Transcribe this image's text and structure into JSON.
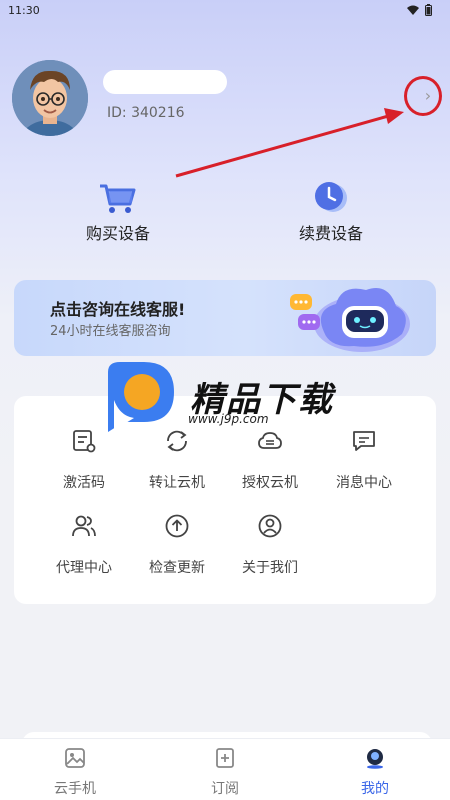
{
  "status_bar": {
    "time": "11:30"
  },
  "profile": {
    "id_text": "ID: 340216",
    "chevron": "›"
  },
  "quick_actions": [
    {
      "label": "购买设备",
      "icon": "cart-icon"
    },
    {
      "label": "续费设备",
      "icon": "clock-icon"
    }
  ],
  "banner": {
    "title": "点击咨询在线客服!",
    "subtitle": "24小时在线客服咨询"
  },
  "watermark": {
    "title": "精品下载",
    "url": "www.j9p.com"
  },
  "menu": [
    {
      "label": "激活码",
      "icon": "activation-code-icon"
    },
    {
      "label": "转让云机",
      "icon": "transfer-icon"
    },
    {
      "label": "授权云机",
      "icon": "cloud-authorize-icon"
    },
    {
      "label": "消息中心",
      "icon": "message-icon"
    },
    {
      "label": "代理中心",
      "icon": "users-icon"
    },
    {
      "label": "检查更新",
      "icon": "upload-icon"
    },
    {
      "label": "关于我们",
      "icon": "user-circle-icon"
    }
  ],
  "tabs": [
    {
      "label": "云手机",
      "icon": "image-icon"
    },
    {
      "label": "订阅",
      "icon": "subscribe-icon"
    },
    {
      "label": "我的",
      "icon": "profile-icon"
    }
  ],
  "colors": {
    "accent": "#3a66e8",
    "annotation": "#d8202a"
  }
}
